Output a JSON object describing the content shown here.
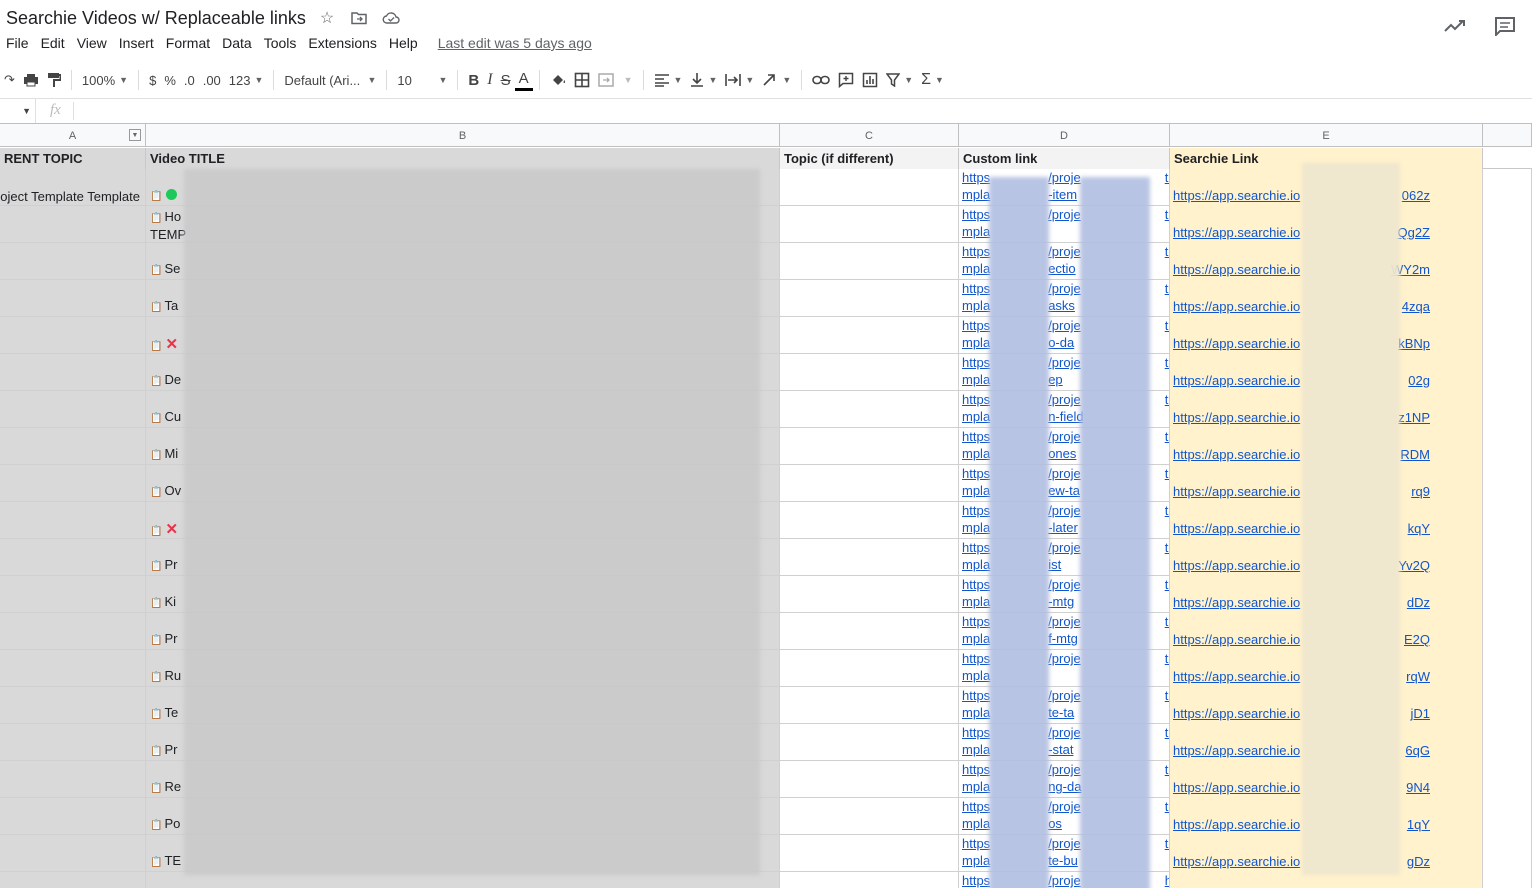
{
  "title": "Searchie Videos w/ Replaceable links",
  "title_icons": [
    "star-icon",
    "move-folder-icon",
    "cloud-status-icon"
  ],
  "menu": [
    "File",
    "Edit",
    "View",
    "Insert",
    "Format",
    "Data",
    "Tools",
    "Extensions",
    "Help"
  ],
  "last_edit": "Last edit was 5 days ago",
  "toolbar": {
    "zoom": "100%",
    "currency": "$",
    "percent": "%",
    "dec_less": ".0",
    "dec_more": ".00",
    "number_format": "123",
    "font": "Default (Ari...",
    "font_size": "10",
    "bold": "B",
    "italic": "I",
    "strike": "S",
    "text_color": "A"
  },
  "formula": {
    "fx": "fx"
  },
  "columns": [
    "A",
    "B",
    "C",
    "D",
    "E"
  ],
  "headers": {
    "a": "RENT TOPIC",
    "b": "Video TITLE",
    "c": "Topic (if different)",
    "d": "Custom link",
    "e": "Searchie Link"
  },
  "rows": [
    {
      "a": "oject Template Template",
      "b": "",
      "status": "green",
      "d1": "https",
      "d1b": "/proje",
      "d1c": "te",
      "d2": "mpla",
      "d2b": "-item",
      "e_pre": "https://app.searchie.io",
      "e_suf": "062z"
    },
    {
      "a": "",
      "b": "Ho",
      "b2": "TEMP",
      "status": "",
      "d1": "https",
      "d1b": "/proje",
      "d1c": "te",
      "d2": "mpla",
      "d2b": "",
      "e_pre": "https://app.searchie.io",
      "e_suf": "Qg2Z"
    },
    {
      "a": "",
      "b": "Se",
      "status": "",
      "d1": "https",
      "d1b": "/proje",
      "d1c": "te",
      "d2": "mpla",
      "d2b": "ectio",
      "e_pre": "https://app.searchie.io",
      "e_suf": "WY2m"
    },
    {
      "a": "",
      "b": "Ta",
      "status": "",
      "d1": "https",
      "d1b": "/proje",
      "d1c": "te",
      "d2": "mpla",
      "d2b": "asks",
      "e_pre": "https://app.searchie.io",
      "e_suf": "4zqa"
    },
    {
      "a": "",
      "b": "",
      "status": "x",
      "d1": "https",
      "d1b": "/proje",
      "d1c": "te",
      "d2": "mpla",
      "d2b": "o-da",
      "e_pre": "https://app.searchie.io",
      "e_suf": "kBNp"
    },
    {
      "a": "",
      "b": "De",
      "status": "",
      "d1": "https",
      "d1b": "/proje",
      "d1c": "te",
      "d2": "mpla",
      "d2b": "ep",
      "e_pre": "https://app.searchie.io",
      "e_suf": "02g"
    },
    {
      "a": "",
      "b": "Cu",
      "status": "",
      "d1": "https",
      "d1b": "/proje",
      "d1c": "te",
      "d2": "mpla",
      "d2b": "n-field",
      "e_pre": "https://app.searchie.io",
      "e_suf": "z1NP"
    },
    {
      "a": "",
      "b": "Mi",
      "status": "",
      "d1": "https",
      "d1b": "/proje",
      "d1c": "te",
      "d2": "mpla",
      "d2b": "ones",
      "e_pre": "https://app.searchie.io",
      "e_suf": "RDM"
    },
    {
      "a": "",
      "b": "Ov",
      "status": "",
      "d1": "https",
      "d1b": "/proje",
      "d1c": "te",
      "d2": "mpla",
      "d2b": "ew-ta",
      "e_pre": "https://app.searchie.io",
      "e_suf": "rq9"
    },
    {
      "a": "",
      "b": "",
      "status": "x",
      "d1": "https",
      "d1b": "/proje",
      "d1c": "te",
      "d2": "mpla",
      "d2b": "-later",
      "e_pre": "https://app.searchie.io",
      "e_suf": "kqY"
    },
    {
      "a": "",
      "b": "Pr",
      "status": "",
      "d1": "https",
      "d1b": "/proje",
      "d1c": "te",
      "d2": "mpla",
      "d2b": "ist",
      "e_pre": "https://app.searchie.io",
      "e_suf": "Yv2Q"
    },
    {
      "a": "",
      "b": "Ki",
      "status": "",
      "d1": "https",
      "d1b": "/proje",
      "d1c": "te",
      "d2": "mpla",
      "d2b": "-mtg",
      "e_pre": "https://app.searchie.io",
      "e_suf": "dDz"
    },
    {
      "a": "",
      "b": "Pr",
      "status": "",
      "d1": "https",
      "d1b": "/proje",
      "d1c": "te",
      "d2": "mpla",
      "d2b": "f-mtg",
      "e_pre": "https://app.searchie.io",
      "e_suf": "E2Q"
    },
    {
      "a": "",
      "b": "Ru",
      "status": "",
      "d1": "https",
      "d1b": "/proje",
      "d1c": "te",
      "d2": "mpla",
      "d2b": "",
      "e_pre": "https://app.searchie.io",
      "e_suf": "rqW"
    },
    {
      "a": "",
      "b": "Te",
      "status": "",
      "d1": "https",
      "d1b": "/proje",
      "d1c": "te",
      "d2": "mpla",
      "d2b": "te-ta",
      "e_pre": "https://app.searchie.io",
      "e_suf": "jD1"
    },
    {
      "a": "",
      "b": "Pr",
      "status": "",
      "d1": "https",
      "d1b": "/proje",
      "d1c": "te",
      "d2": "mpla",
      "d2b": "-stat",
      "e_pre": "https://app.searchie.io",
      "e_suf": "6qG"
    },
    {
      "a": "",
      "b": "Re",
      "status": "",
      "d1": "https",
      "d1b": "/proje",
      "d1c": "te",
      "d2": "mpla",
      "d2b": "ng-da",
      "e_pre": "https://app.searchie.io",
      "e_suf": "9N4"
    },
    {
      "a": "",
      "b": "Po",
      "status": "",
      "d1": "https",
      "d1b": "/proje",
      "d1c": "te",
      "d2": "mpla",
      "d2b": "os",
      "e_pre": "https://app.searchie.io",
      "e_suf": "1qY"
    },
    {
      "a": "",
      "b": "TE",
      "status": "",
      "d1": "https",
      "d1b": "/proje",
      "d1c": "te",
      "d2": "mpla",
      "d2b": "te-bu",
      "e_pre": "https://app.searchie.io",
      "e_suf": "gDz"
    },
    {
      "a": "",
      "b": "",
      "status": "",
      "d1": "https",
      "d1b": "/proje",
      "d1c": "h",
      "d2": "",
      "d2b": "",
      "e_pre": "",
      "e_suf": ""
    }
  ]
}
